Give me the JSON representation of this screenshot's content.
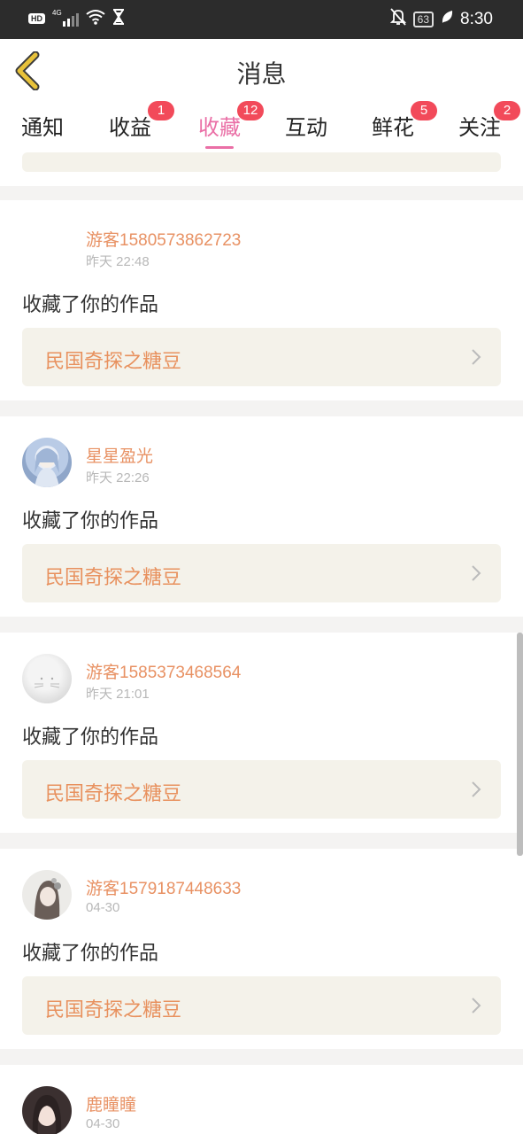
{
  "status_bar": {
    "hd": "HD",
    "network": "4G",
    "battery": "63",
    "time": "8:30"
  },
  "header": {
    "title": "消息"
  },
  "tabs": [
    {
      "label": "通知",
      "badge": ""
    },
    {
      "label": "收益",
      "badge": "1"
    },
    {
      "label": "收藏",
      "badge": "12",
      "active": true
    },
    {
      "label": "互动",
      "badge": ""
    },
    {
      "label": "鲜花",
      "badge": "5"
    },
    {
      "label": "关注",
      "badge": "2"
    }
  ],
  "messages": [
    {
      "user": "游客1580573862723",
      "time": "昨天 22:48",
      "action": "收藏了你的作品",
      "work": "民国奇探之糖豆"
    },
    {
      "user": "星星盈光",
      "time": "昨天 22:26",
      "action": "收藏了你的作品",
      "work": "民国奇探之糖豆"
    },
    {
      "user": "游客1585373468564",
      "time": "昨天 21:01",
      "action": "收藏了你的作品",
      "work": "民国奇探之糖豆"
    },
    {
      "user": "游客1579187448633",
      "time": "04-30",
      "action": "收藏了你的作品",
      "work": "民国奇探之糖豆"
    },
    {
      "user": "鹿瞳瞳",
      "time": "04-30"
    }
  ],
  "colors": {
    "accent_pink": "#ea6fa6",
    "badge_red": "#f24a5a",
    "username_orange": "#e89163",
    "work_bg": "#f4f2ea",
    "back_arrow": "#e8c23a"
  }
}
